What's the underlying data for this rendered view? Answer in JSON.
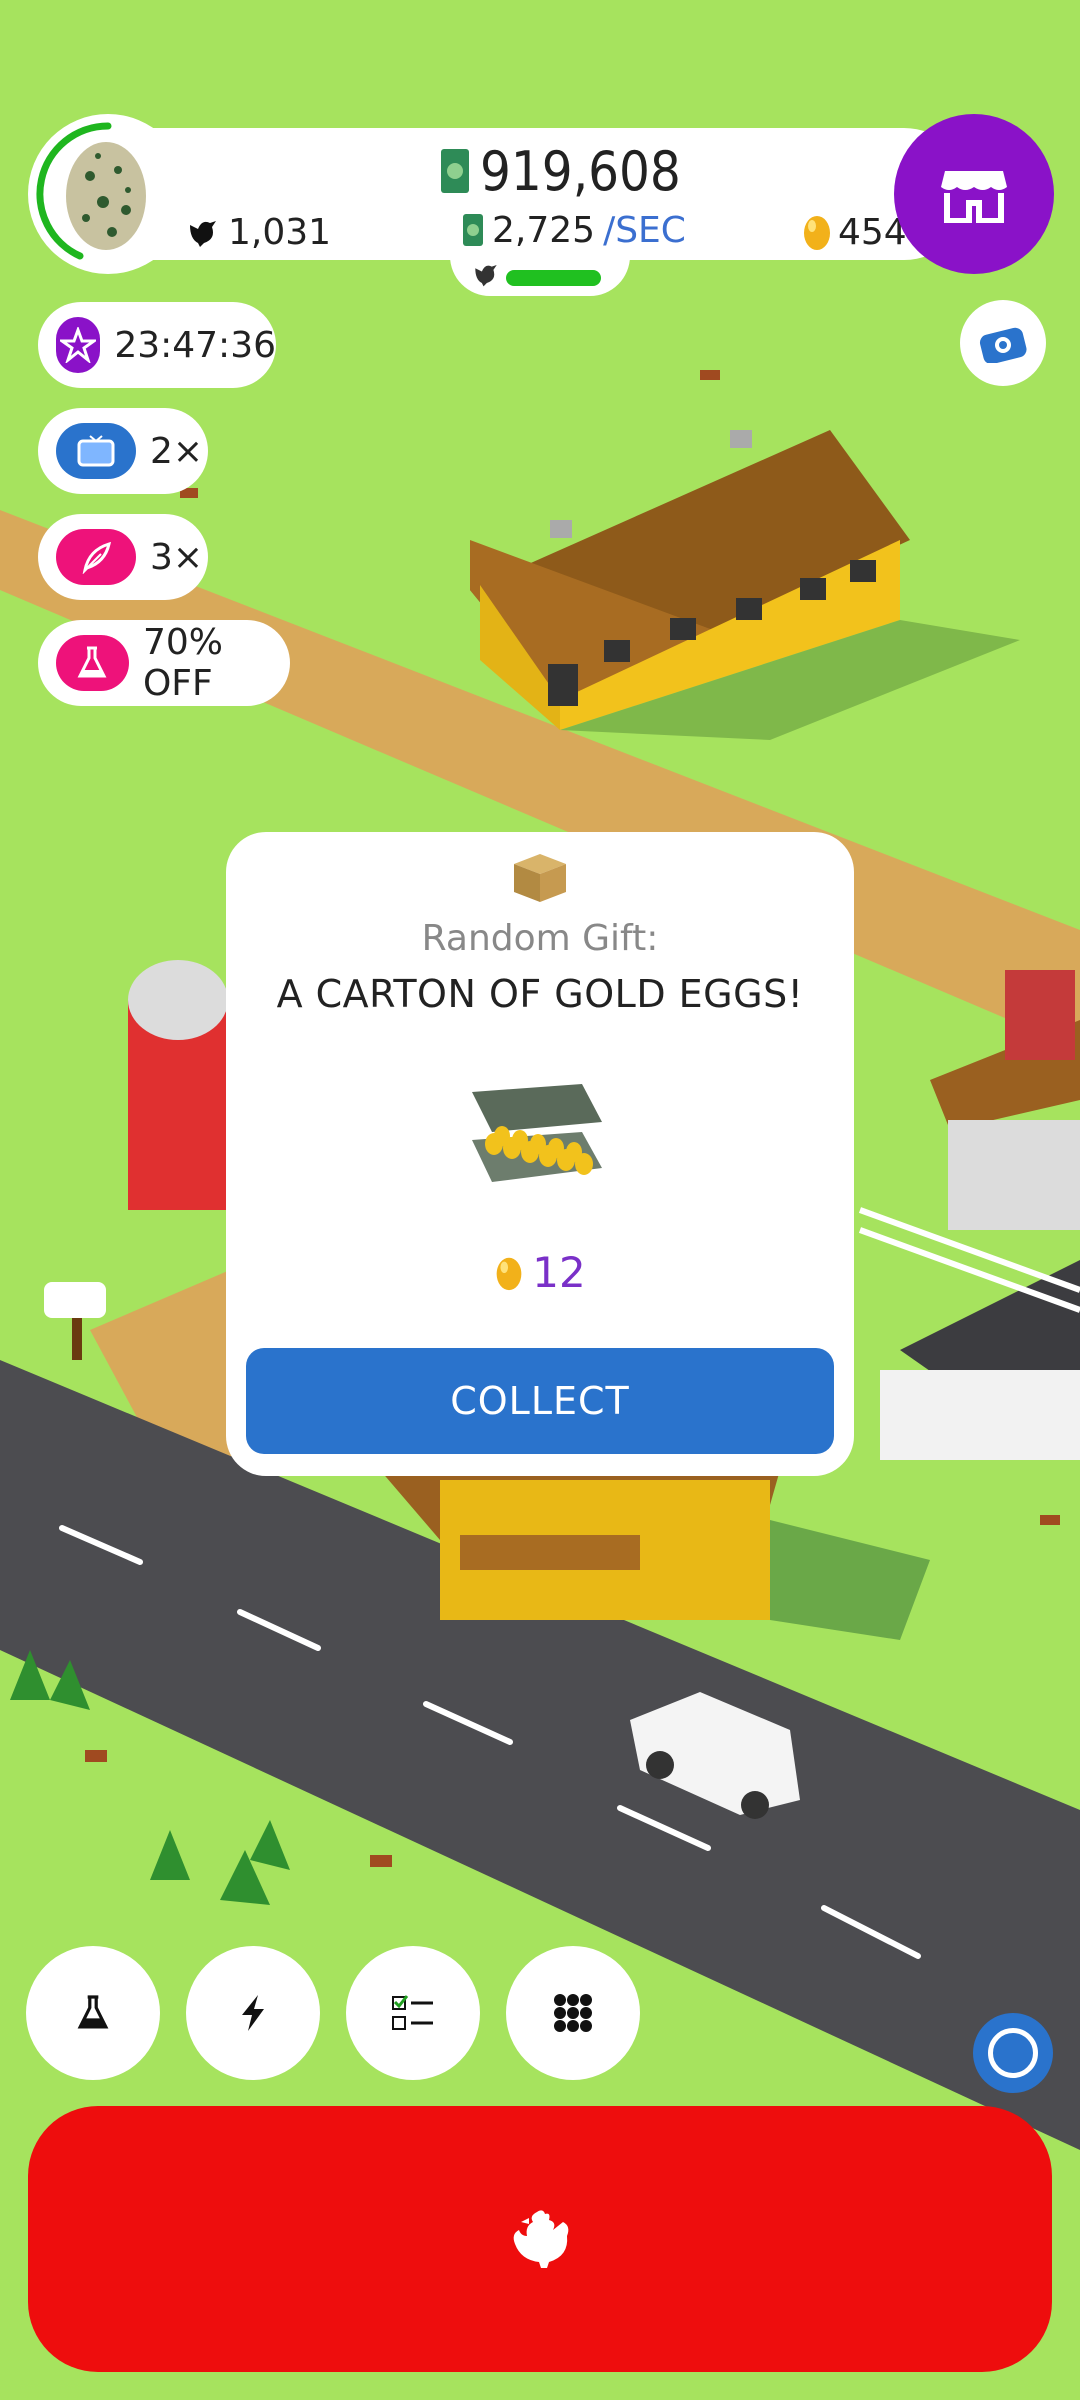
{
  "hud": {
    "money": "919,608",
    "rate_value": "2,725",
    "rate_unit": "/SEC",
    "chicken_count": "1,031",
    "gold_eggs": "454",
    "production_progress": 0.85
  },
  "boosts": {
    "timer": "23:47:36",
    "video_multiplier": "2×",
    "feather_multiplier": "3×",
    "research_discount": "70% OFF"
  },
  "modal": {
    "title": "Random Gift:",
    "subtitle": "A CARTON OF GOLD EGGS!",
    "reward_amount": "12",
    "collect_label": "COLLECT"
  },
  "icons": {
    "shop": "shop-icon",
    "camera": "camera-icon",
    "research": "flask-icon",
    "boosts": "lightning-icon",
    "tasks": "checklist-icon",
    "menu": "grid-icon",
    "hatch": "chicken-icon"
  },
  "colors": {
    "grass": "#a6e35e",
    "shop_purple": "#8a12c8",
    "collect_blue": "#2a73cc",
    "hatch_red": "#ee0d0d",
    "gold": "#f2b11a"
  }
}
